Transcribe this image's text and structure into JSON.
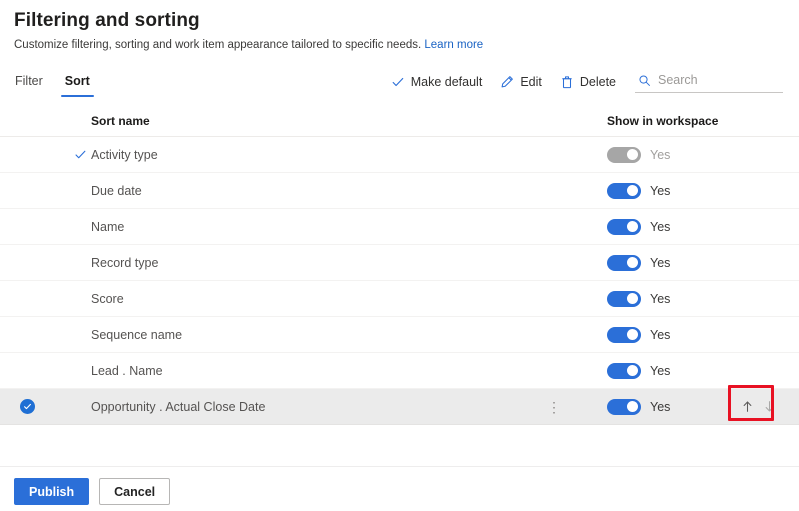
{
  "header": {
    "title": "Filtering and sorting",
    "subtitle": "Customize filtering, sorting and work item appearance tailored to specific needs.",
    "learn_more": "Learn more"
  },
  "tabs": [
    {
      "label": "Filter",
      "active": false
    },
    {
      "label": "Sort",
      "active": true
    }
  ],
  "commands": [
    {
      "label": "Make default",
      "icon": "checkmark-icon"
    },
    {
      "label": "Edit",
      "icon": "pencil-icon"
    },
    {
      "label": "Delete",
      "icon": "trash-icon"
    }
  ],
  "search": {
    "placeholder": "Search",
    "value": "",
    "icon": "search-icon"
  },
  "table": {
    "columns": {
      "sort_name": "Sort name",
      "show_in_workspace": "Show in workspace"
    },
    "rows": [
      {
        "name": "Activity type",
        "is_default": true,
        "selected": false,
        "toggle_on": true,
        "toggle_disabled": true,
        "toggle_label": "Yes"
      },
      {
        "name": "Due date",
        "is_default": false,
        "selected": false,
        "toggle_on": true,
        "toggle_disabled": false,
        "toggle_label": "Yes"
      },
      {
        "name": "Name",
        "is_default": false,
        "selected": false,
        "toggle_on": true,
        "toggle_disabled": false,
        "toggle_label": "Yes"
      },
      {
        "name": "Record type",
        "is_default": false,
        "selected": false,
        "toggle_on": true,
        "toggle_disabled": false,
        "toggle_label": "Yes"
      },
      {
        "name": "Score",
        "is_default": false,
        "selected": false,
        "toggle_on": true,
        "toggle_disabled": false,
        "toggle_label": "Yes"
      },
      {
        "name": "Sequence name",
        "is_default": false,
        "selected": false,
        "toggle_on": true,
        "toggle_disabled": false,
        "toggle_label": "Yes"
      },
      {
        "name": "Lead . Name",
        "is_default": false,
        "selected": false,
        "toggle_on": true,
        "toggle_disabled": false,
        "toggle_label": "Yes"
      },
      {
        "name": "Opportunity . Actual Close Date",
        "is_default": false,
        "selected": true,
        "toggle_on": true,
        "toggle_disabled": false,
        "toggle_label": "Yes",
        "overflow_menu": "⋮",
        "move_up": "move-up-arrow-icon",
        "move_down": "move-down-arrow-icon"
      }
    ]
  },
  "footer": {
    "publish": "Publish",
    "cancel": "Cancel"
  },
  "annotation": {
    "color": "#e81123",
    "target": "reorder-arrows"
  }
}
